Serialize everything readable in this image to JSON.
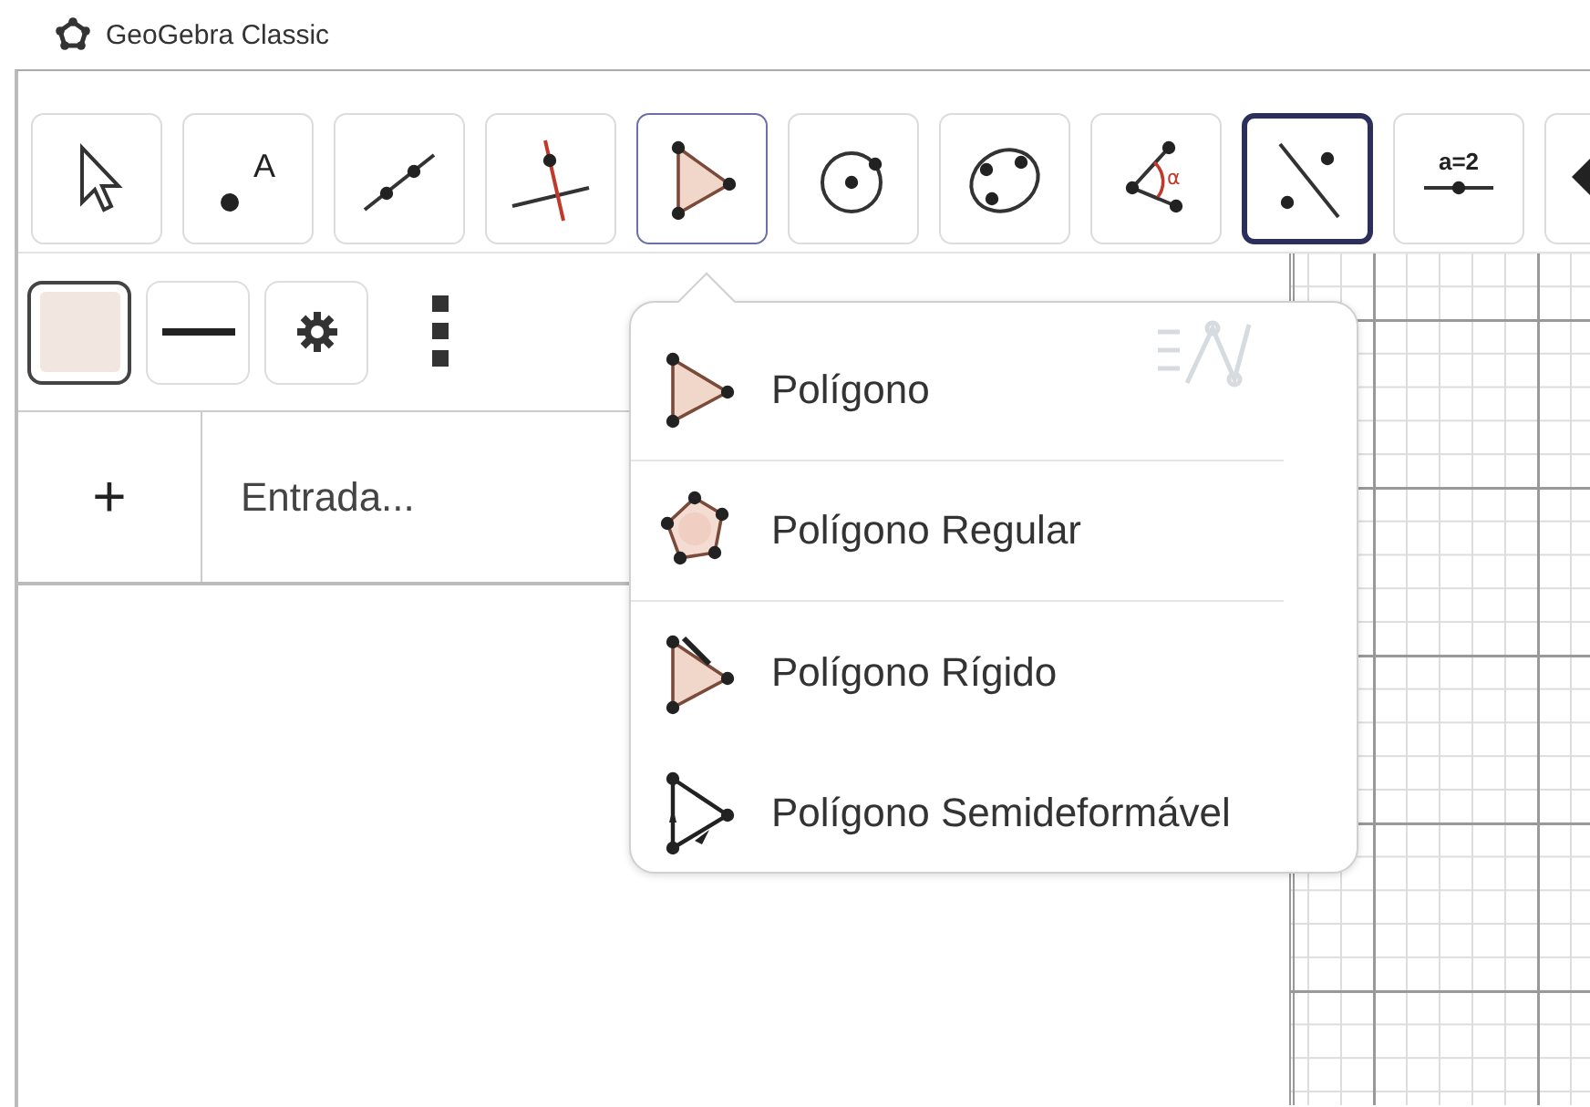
{
  "window": {
    "title": "GeoGebra Classic"
  },
  "toolbar": {
    "tools": [
      {
        "kind": "move",
        "selected": false,
        "menu_open": false
      },
      {
        "kind": "point",
        "label": "A",
        "selected": false,
        "menu_open": false
      },
      {
        "kind": "line",
        "selected": false,
        "menu_open": false
      },
      {
        "kind": "perpendicular",
        "selected": false,
        "menu_open": false
      },
      {
        "kind": "polygon",
        "selected": false,
        "menu_open": true
      },
      {
        "kind": "circle",
        "selected": false,
        "menu_open": false
      },
      {
        "kind": "conic",
        "selected": false,
        "menu_open": false
      },
      {
        "kind": "angle",
        "label": "α",
        "selected": false,
        "menu_open": false
      },
      {
        "kind": "reflect",
        "selected": true,
        "menu_open": false
      },
      {
        "kind": "slider",
        "label": "a=2",
        "selected": false,
        "menu_open": false
      },
      {
        "kind": "transform",
        "selected": false,
        "menu_open": false
      }
    ]
  },
  "style_bar": {
    "buttons": [
      {
        "kind": "color",
        "selected": true
      },
      {
        "kind": "line_style",
        "selected": false
      },
      {
        "kind": "settings",
        "selected": false
      },
      {
        "kind": "more",
        "selected": false
      }
    ]
  },
  "algebra": {
    "add_symbol": "+",
    "input": {
      "placeholder": "Entrada..."
    }
  },
  "tool_menu": {
    "items": [
      {
        "kind": "polygon",
        "label": "Polígono",
        "divider_after": true
      },
      {
        "kind": "regular",
        "label": "Polígono Regular",
        "divider_after": true
      },
      {
        "kind": "rigid",
        "label": "Polígono Rígido",
        "divider_after": false
      },
      {
        "kind": "vector",
        "label": "Polígono Semideformável",
        "divider_after": false
      }
    ]
  }
}
